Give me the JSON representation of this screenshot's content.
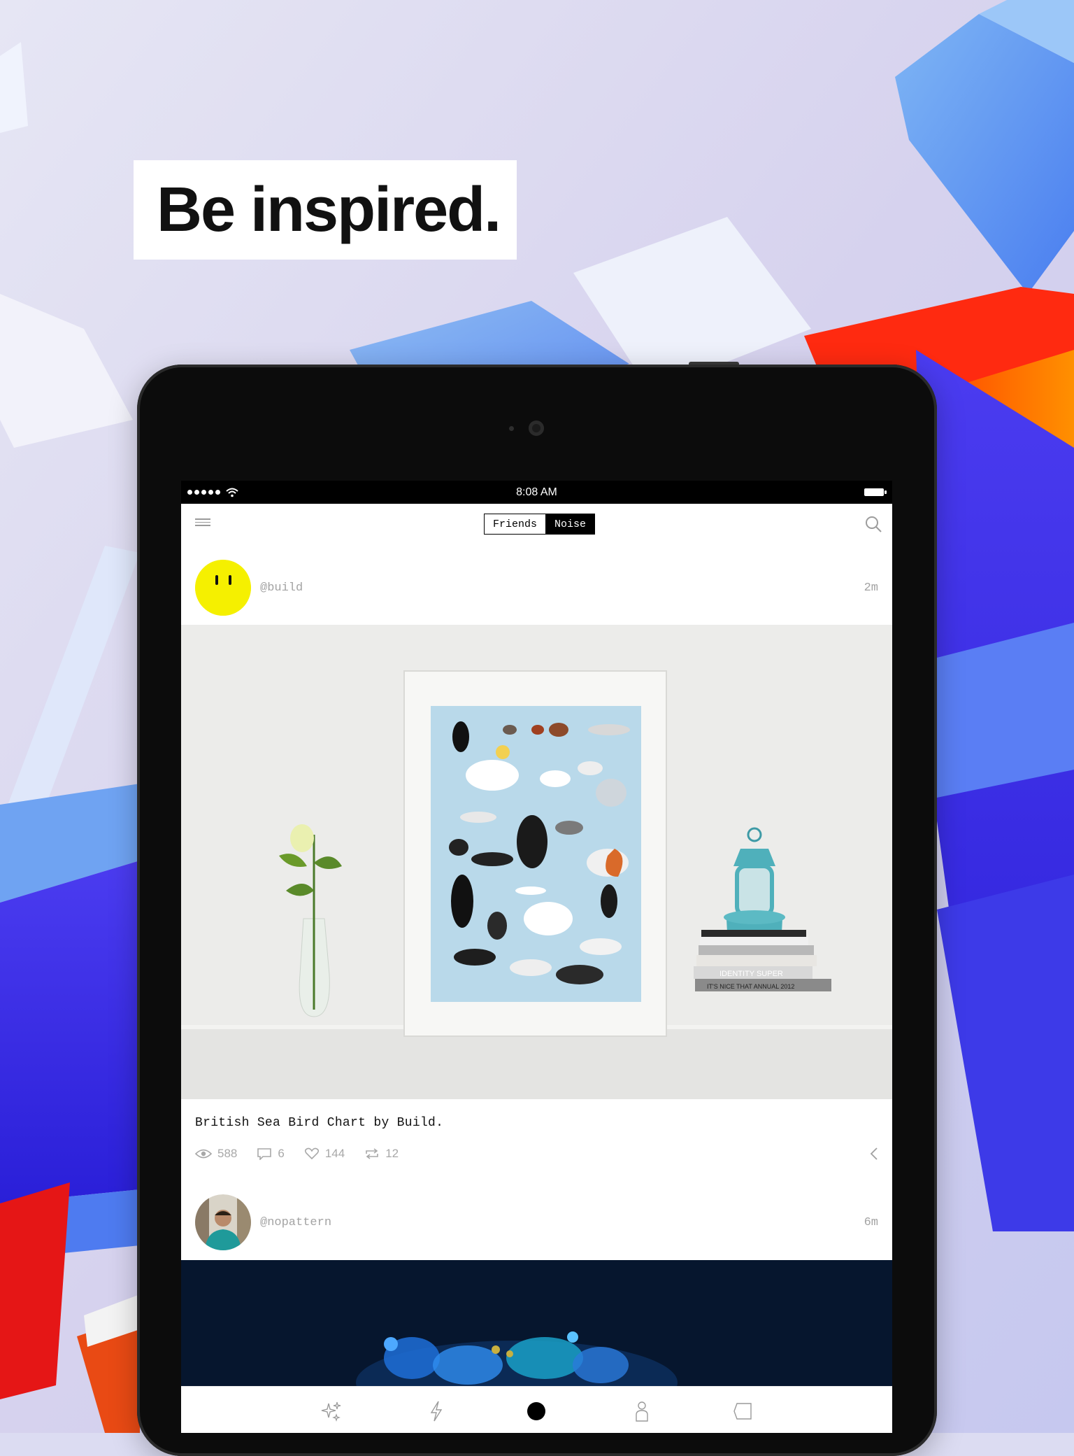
{
  "marketing": {
    "headline": "Be inspired."
  },
  "status_bar": {
    "time": "8:08 AM"
  },
  "nav": {
    "tabs": [
      {
        "label": "Friends",
        "selected": false
      },
      {
        "label": "Noise",
        "selected": true
      }
    ],
    "menu_icon": "hamburger-menu-icon",
    "search_icon": "search-icon"
  },
  "feed": {
    "posts": [
      {
        "username": "@build",
        "time": "2m",
        "caption": "British Sea Bird Chart by Build.",
        "stats": {
          "views": "588",
          "comments": "6",
          "likes": "144",
          "reposts": "12"
        }
      },
      {
        "username": "@nopattern",
        "time": "6m"
      }
    ]
  },
  "photo_text": {
    "book_spine": "IT'S NICE THAT ANNUAL 2012",
    "book_spine_2": "IDENTITY SUPER"
  },
  "tab_bar": {
    "icons": [
      "sparkle-icon",
      "bolt-icon",
      "record-dot-icon",
      "profile-icon",
      "tag-icon"
    ]
  },
  "colors": {
    "accent_yellow": "#f5f000",
    "background_blue": "#3d35e6",
    "background_orange": "#ff6a00",
    "background_red": "#e01010",
    "poster_blue": "#b9d9ea"
  }
}
